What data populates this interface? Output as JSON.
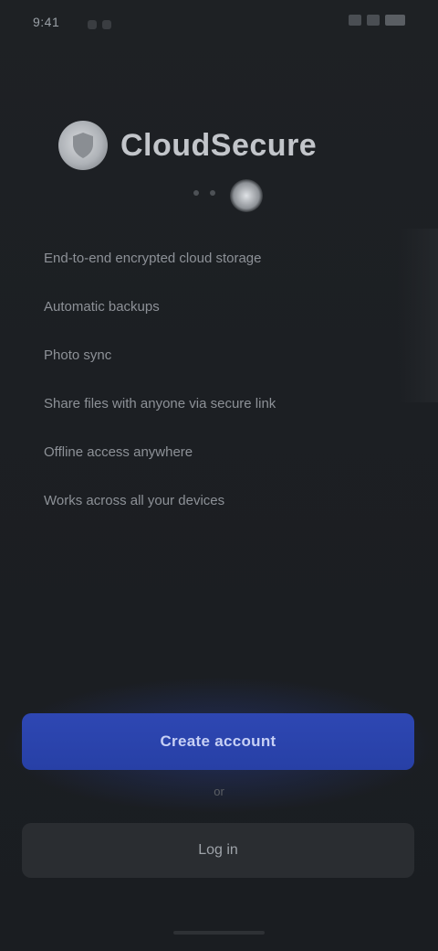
{
  "status_bar": {
    "time": "9:41"
  },
  "header": {
    "app_name": "CloudSecure",
    "logo_icon": "shield-icon"
  },
  "features": [
    {
      "label": "End-to-end encrypted cloud storage"
    },
    {
      "label": "Automatic backups"
    },
    {
      "label": "Photo sync"
    },
    {
      "label": "Share files with anyone via secure link"
    },
    {
      "label": "Offline access anywhere"
    },
    {
      "label": "Works across all your devices"
    }
  ],
  "actions": {
    "primary_label": "Create account",
    "divider": "or",
    "secondary_label": "Log in"
  },
  "colors": {
    "background": "#1c1f23",
    "primary": "#2e47b3",
    "secondary": "#2a2d31"
  }
}
